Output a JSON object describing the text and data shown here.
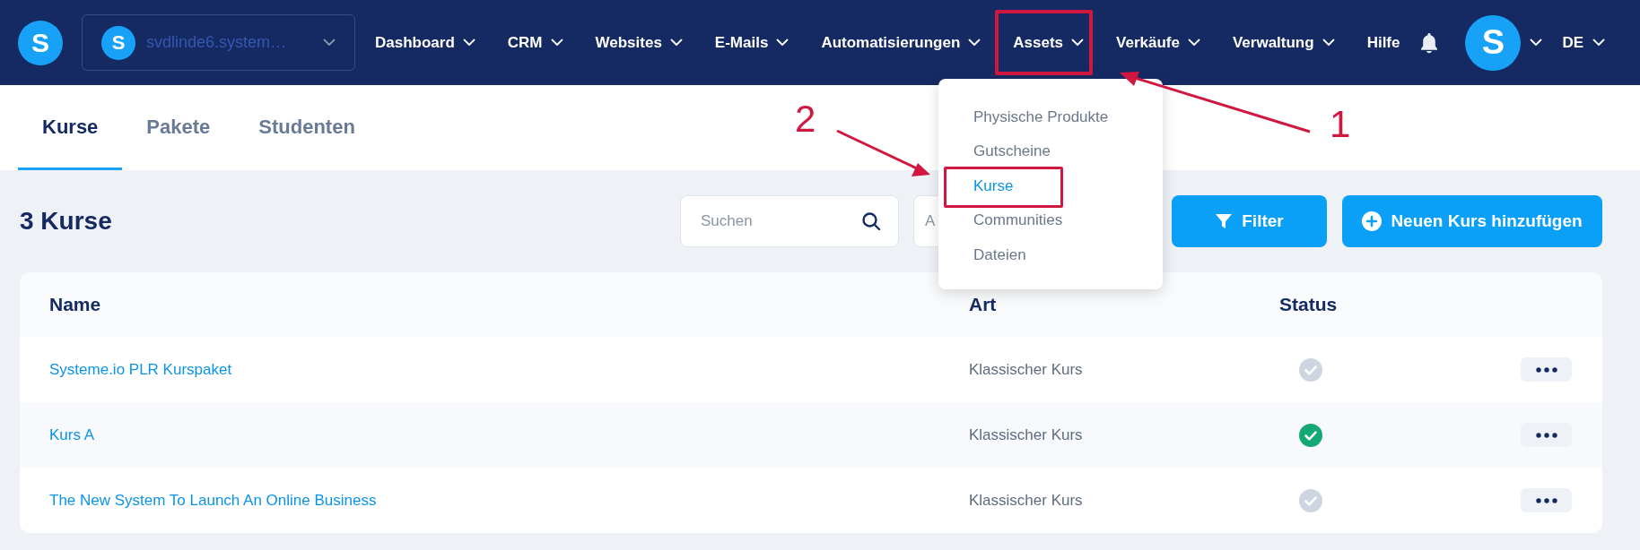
{
  "nav": {
    "logo": "S",
    "workspace": {
      "avatar": "S",
      "name": "svdlinde6.system…"
    },
    "items": [
      {
        "label": "Dashboard",
        "has_menu": true,
        "annotated": false
      },
      {
        "label": "CRM",
        "has_menu": true,
        "annotated": false
      },
      {
        "label": "Websites",
        "has_menu": true,
        "annotated": false
      },
      {
        "label": "E-Mails",
        "has_menu": true,
        "annotated": false
      },
      {
        "label": "Automatisierungen",
        "has_menu": true,
        "annotated": false
      },
      {
        "label": "Assets",
        "has_menu": true,
        "annotated": true
      },
      {
        "label": "Verkäufe",
        "has_menu": true,
        "annotated": false
      },
      {
        "label": "Verwaltung",
        "has_menu": true,
        "annotated": false
      },
      {
        "label": "Hilfe",
        "has_menu": false,
        "annotated": false
      }
    ],
    "user_avatar": "S",
    "language": "DE"
  },
  "dropdown": [
    {
      "label": "Physische Produkte",
      "selected": false,
      "annotated": false
    },
    {
      "label": "Gutscheine",
      "selected": false,
      "annotated": false
    },
    {
      "label": "Kurse",
      "selected": true,
      "annotated": true
    },
    {
      "label": "Communities",
      "selected": false,
      "annotated": false
    },
    {
      "label": "Dateien",
      "selected": false,
      "annotated": false
    }
  ],
  "tabs": [
    {
      "label": "Kurse",
      "selected": true
    },
    {
      "label": "Pakete",
      "selected": false
    },
    {
      "label": "Studenten",
      "selected": false
    }
  ],
  "heading": "3 Kurse",
  "search": {
    "placeholder": "Suchen"
  },
  "second_field": {
    "placeholder": "A"
  },
  "buttons": {
    "filter": "Filter",
    "add": "Neuen Kurs hinzufügen"
  },
  "table": {
    "columns": [
      "Name",
      "Art",
      "Status"
    ],
    "rows": [
      {
        "name": "Systeme.io PLR Kurspaket",
        "type": "Klassischer Kurs",
        "published": false
      },
      {
        "name": "Kurs A",
        "type": "Klassischer Kurs",
        "published": true
      },
      {
        "name": "The New System To Launch An Online Business",
        "type": "Klassischer Kurs",
        "published": false
      }
    ]
  },
  "annotations": {
    "labels": [
      "2",
      "1"
    ]
  }
}
